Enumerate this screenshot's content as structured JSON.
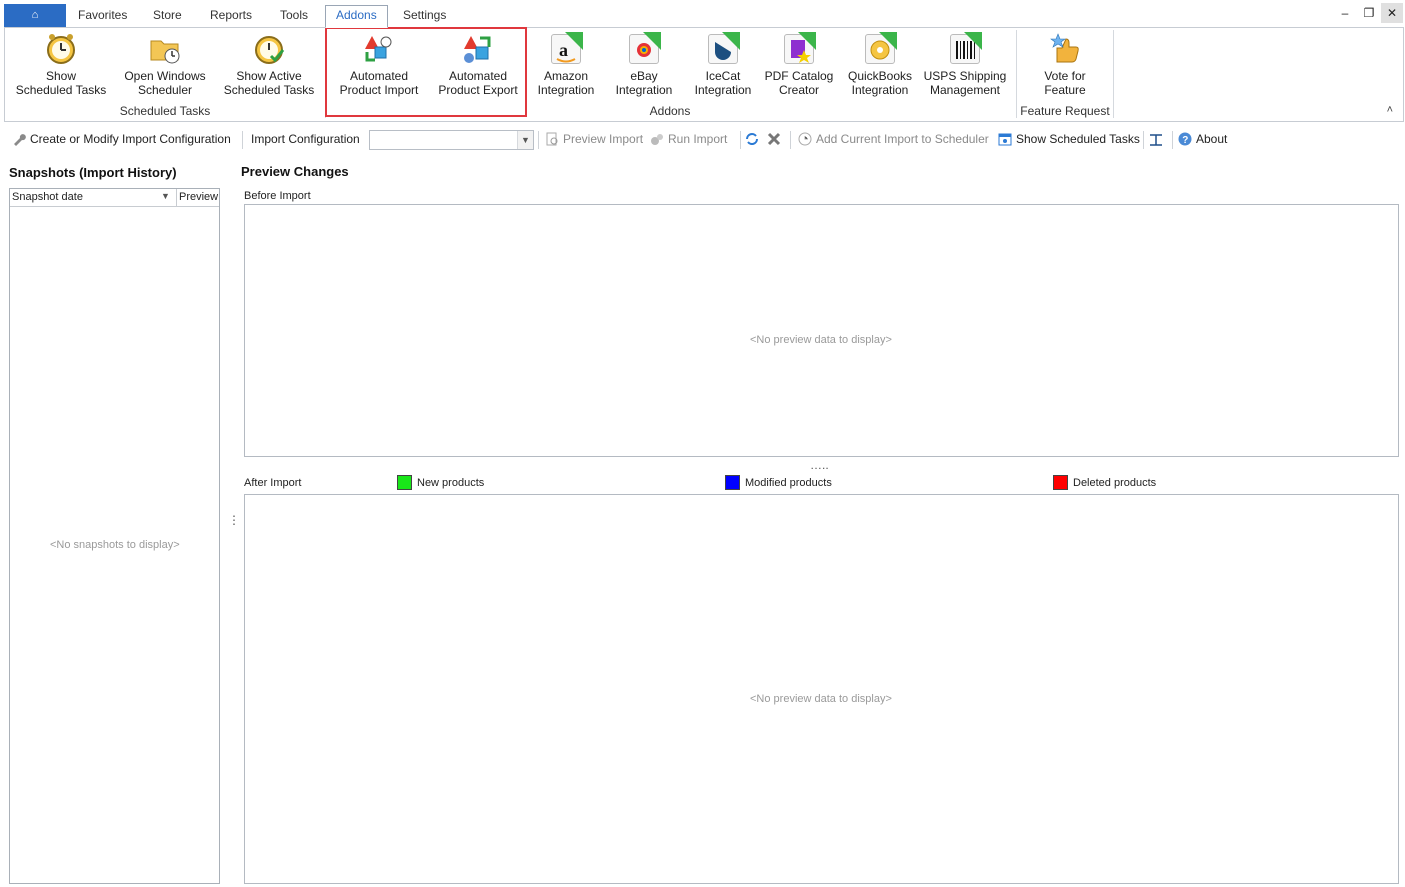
{
  "tabs": {
    "app_button": "⌂",
    "items": [
      "Favorites",
      "Store",
      "Reports",
      "Tools",
      "Addons",
      "Settings"
    ],
    "active": "Addons"
  },
  "window_controls": {
    "minimize": "–",
    "restore": "❐",
    "close": "✕"
  },
  "ribbon": {
    "groups": {
      "scheduled_tasks": "Scheduled Tasks",
      "addons": "Addons",
      "feature_request": "Feature Request"
    },
    "buttons": {
      "show_scheduled_tasks": [
        "Show",
        "Scheduled Tasks"
      ],
      "open_windows_scheduler": [
        "Open Windows",
        "Scheduler"
      ],
      "show_active_tasks": [
        "Show Active",
        "Scheduled Tasks"
      ],
      "automated_import": [
        "Automated",
        "Product Import"
      ],
      "automated_export": [
        "Automated",
        "Product Export"
      ],
      "amazon": [
        "Amazon",
        "Integration"
      ],
      "ebay": [
        "eBay",
        "Integration"
      ],
      "icecat": [
        "IceCat",
        "Integration"
      ],
      "pdf_catalog": [
        "PDF Catalog",
        "Creator"
      ],
      "quickbooks": [
        "QuickBooks",
        "Integration"
      ],
      "usps": [
        "USPS Shipping",
        "Management"
      ],
      "vote": [
        "Vote for",
        "Feature"
      ]
    },
    "collapse_glyph": "˄"
  },
  "toolbar": {
    "create_modify": "Create or Modify Import Configuration",
    "import_config_label": "Import Configuration",
    "import_config_value": "",
    "preview_import": "Preview Import",
    "run_import": "Run Import",
    "add_to_scheduler": "Add Current Import to Scheduler",
    "show_scheduled_tasks": "Show Scheduled Tasks",
    "about": "About"
  },
  "snapshots": {
    "title": "Snapshots (Import History)",
    "columns": [
      "Snapshot date",
      "Preview"
    ],
    "empty": "<No snapshots to display>"
  },
  "preview": {
    "title": "Preview Changes",
    "before_label": "Before Import",
    "after_label": "After Import",
    "before_empty": "<No preview data to display>",
    "after_empty": "<No preview data to display>",
    "legend": [
      {
        "label": "New products",
        "color": "#19e619"
      },
      {
        "label": "Modified products",
        "color": "#0000ff"
      },
      {
        "label": "Deleted products",
        "color": "#ff0000"
      }
    ]
  }
}
